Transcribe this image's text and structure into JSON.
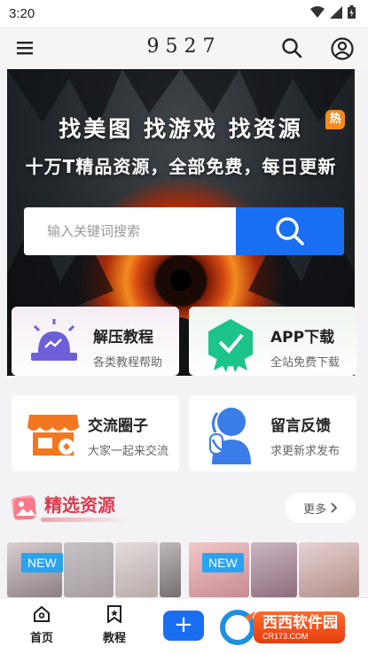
{
  "status_bar": {
    "time": "3:20",
    "icons": [
      "settings-icon",
      "wifi-icon",
      "signal-icon",
      "battery-icon"
    ]
  },
  "header": {
    "title": "9527",
    "menu_icon": "hamburger-menu-icon",
    "search_icon": "search-icon",
    "user_icon": "user-account-icon"
  },
  "hero": {
    "headline": "找美图  找游戏  找资源",
    "hot_badge": "热",
    "subline": "十万T精品资源，全部免费，每日更新",
    "search": {
      "placeholder": "输入关键词搜索",
      "value": ""
    }
  },
  "features": [
    {
      "title": "解压教程",
      "desc": "各类教程帮助",
      "icon": "alarm-siren-icon",
      "color": "#6c5fd8"
    },
    {
      "title": "APP下载",
      "desc": "全站免费下载",
      "icon": "download-badge-icon",
      "color": "#1cc48a"
    },
    {
      "title": "交流圈子",
      "desc": "大家一起来交流",
      "icon": "storefront-icon",
      "color": "#f3771f"
    },
    {
      "title": "留言反馈",
      "desc": "求更新求发布",
      "icon": "customer-service-icon",
      "color": "#3b7de8"
    }
  ],
  "section": {
    "title": "精选资源",
    "more": "更多",
    "icon": "gallery-icon"
  },
  "thumbnails": [
    {
      "badge": "NEW"
    },
    {
      "badge": "NEW"
    }
  ],
  "bottom_nav": [
    {
      "label": "首页",
      "icon": "home-icon"
    },
    {
      "label": "教程",
      "icon": "bookmark-icon"
    },
    {
      "label": "+",
      "icon": "plus-icon"
    }
  ],
  "watermark": {
    "main": "西西软件园",
    "sub": "CR173.COM"
  },
  "colors": {
    "accent": "#1a6ef2",
    "section_title": "#d93a4f",
    "new_badge": "#2aa3f0",
    "hot_badge": "#f38b1c"
  }
}
